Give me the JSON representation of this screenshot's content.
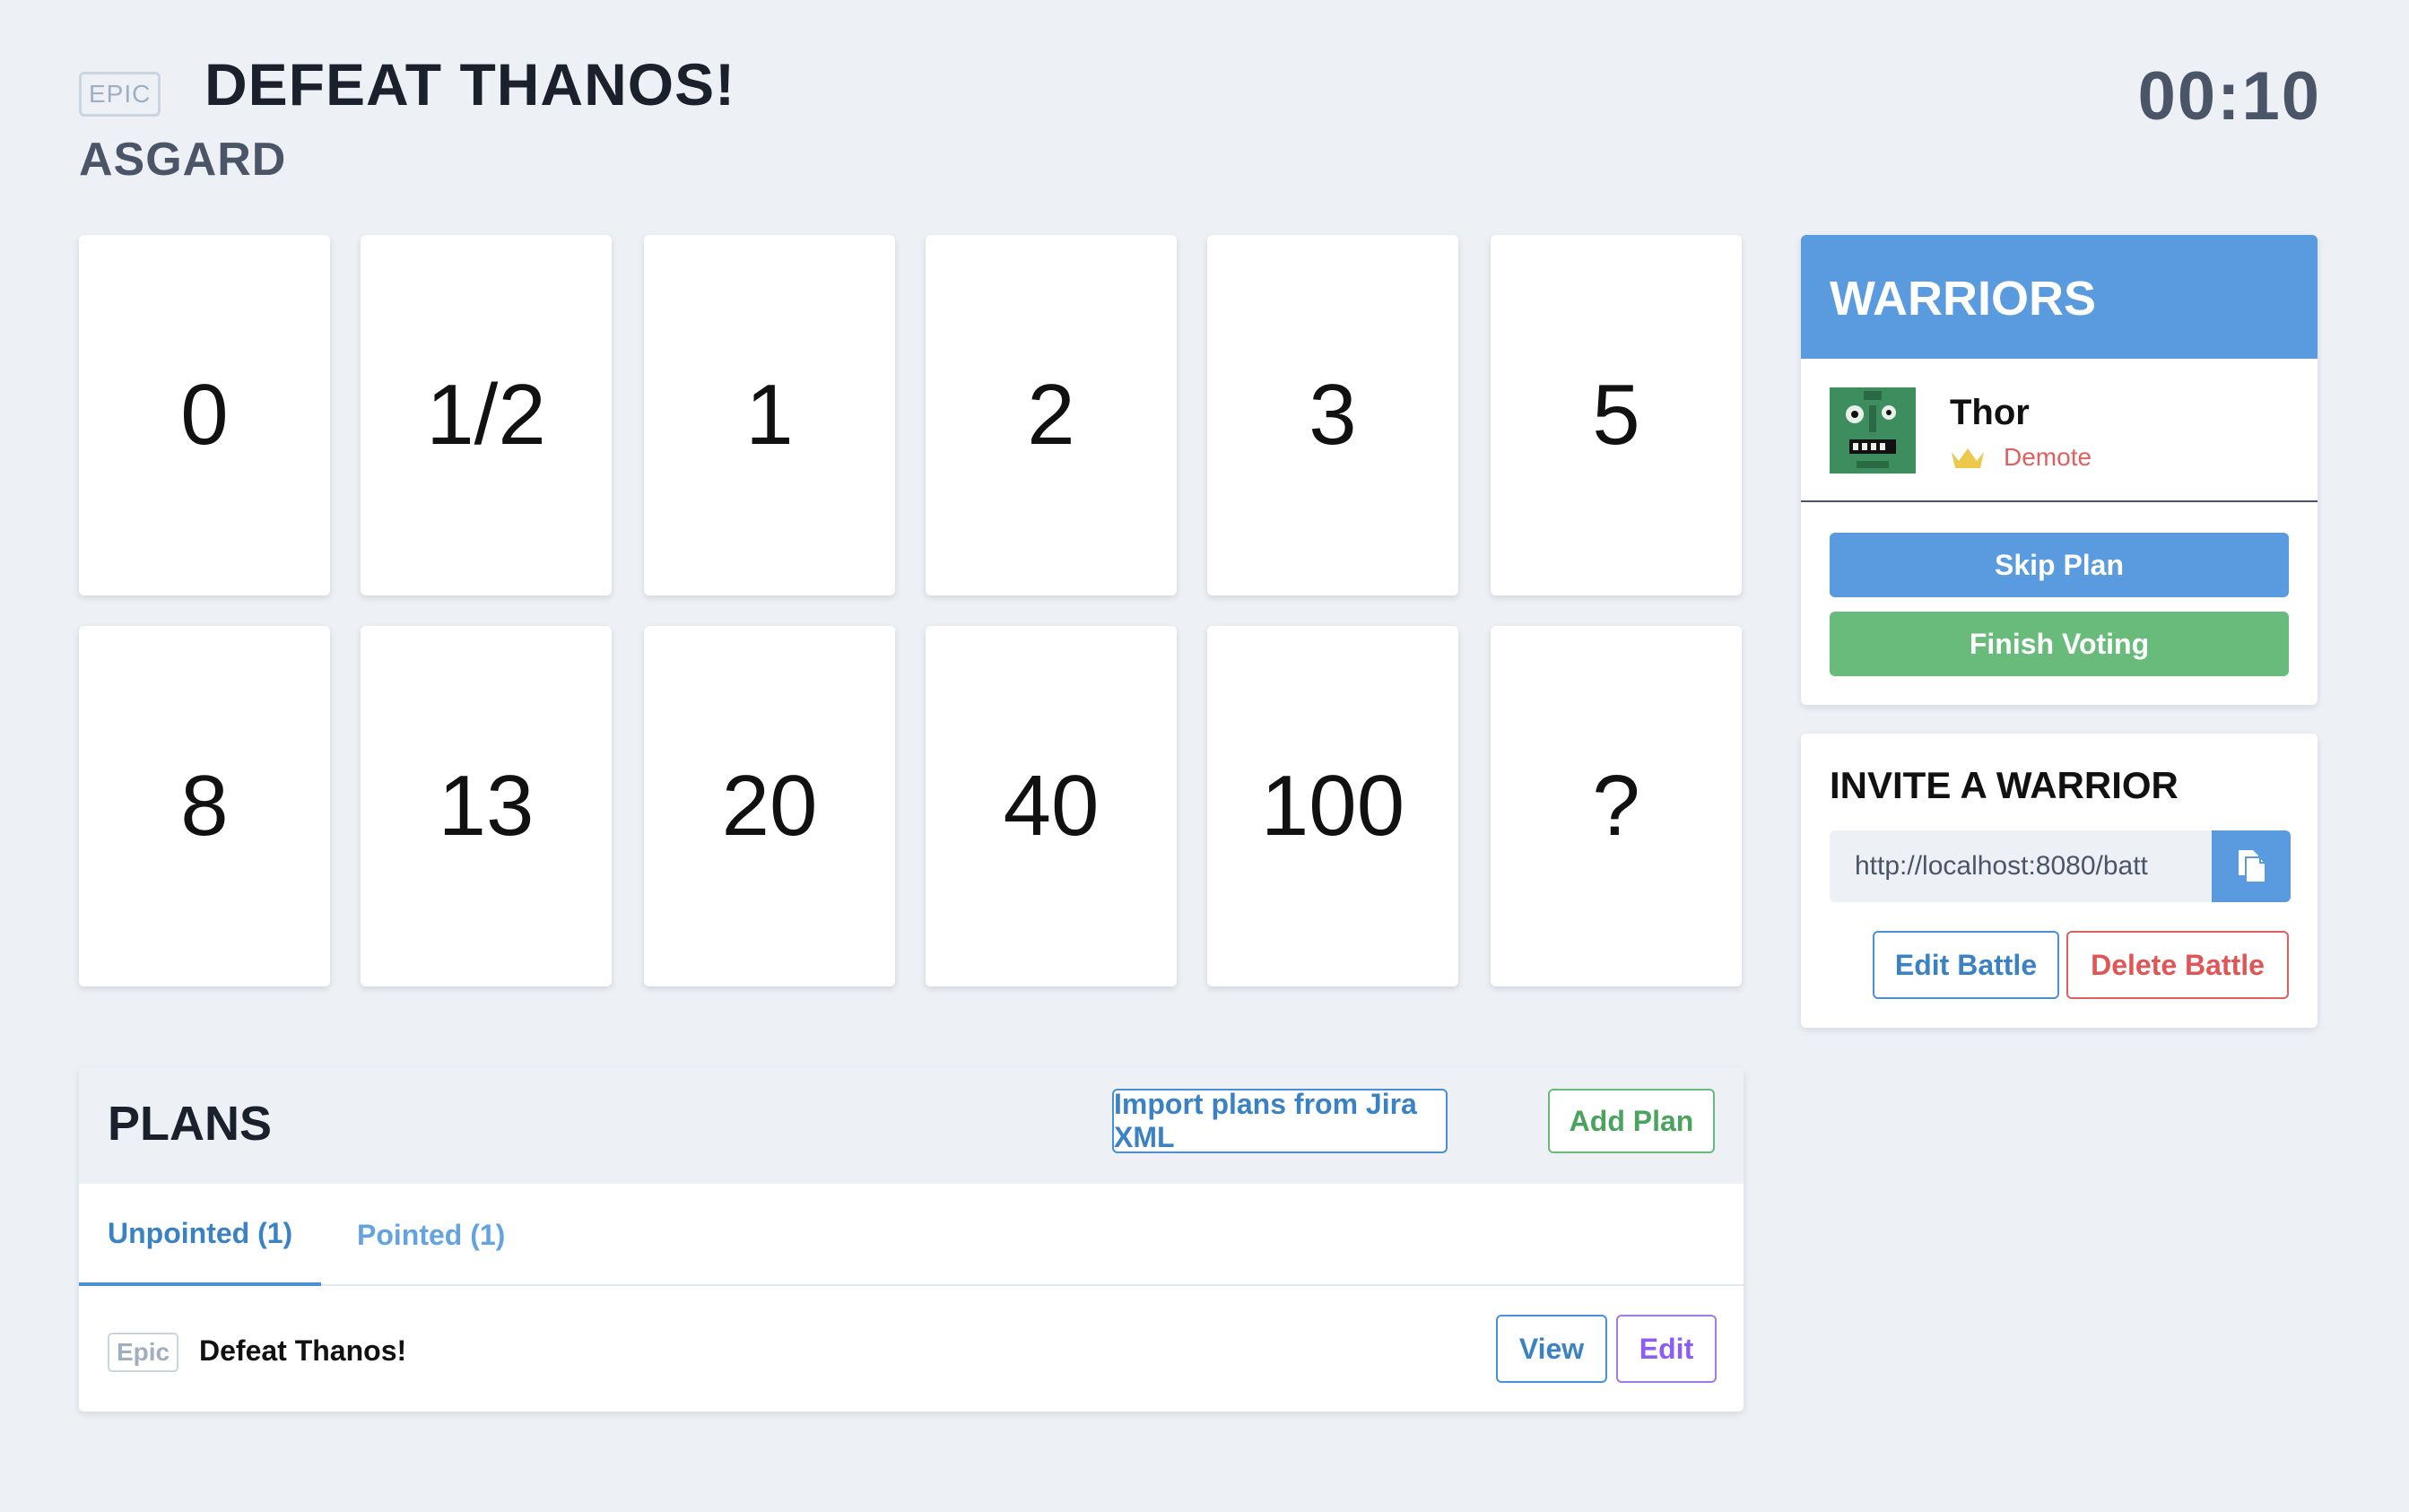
{
  "header": {
    "epic_label": "EPIC",
    "plan_title": "DEFEAT THANOS!",
    "battle_name": "ASGARD",
    "timer": "00:10"
  },
  "cards": [
    "0",
    "1/2",
    "1",
    "2",
    "3",
    "5",
    "8",
    "13",
    "20",
    "40",
    "100",
    "?"
  ],
  "plans": {
    "title": "PLANS",
    "import_label": "Import plans from Jira XML",
    "add_label": "Add Plan",
    "tabs": [
      {
        "label": "Unpointed (1)",
        "active": true
      },
      {
        "label": "Pointed (1)",
        "active": false
      }
    ],
    "rows": [
      {
        "badge": "Epic",
        "name": "Defeat Thanos!",
        "view_label": "View",
        "edit_label": "Edit"
      }
    ]
  },
  "warriors": {
    "title": "WARRIORS",
    "list": [
      {
        "name": "Thor",
        "role_icon": "crown-icon",
        "action_label": "Demote"
      }
    ],
    "skip_label": "Skip Plan",
    "finish_label": "Finish Voting"
  },
  "invite": {
    "title": "INVITE A WARRIOR",
    "link_value": "http://localhost:8080/batt",
    "copy_icon": "copy-icon",
    "edit_label": "Edit Battle",
    "delete_label": "Delete Battle"
  },
  "colors": {
    "background": "#edf1f6",
    "primary_blue": "#5a9ade",
    "success_green": "#68bb7a",
    "danger_red": "#e06060",
    "purple": "#9f7aea"
  }
}
